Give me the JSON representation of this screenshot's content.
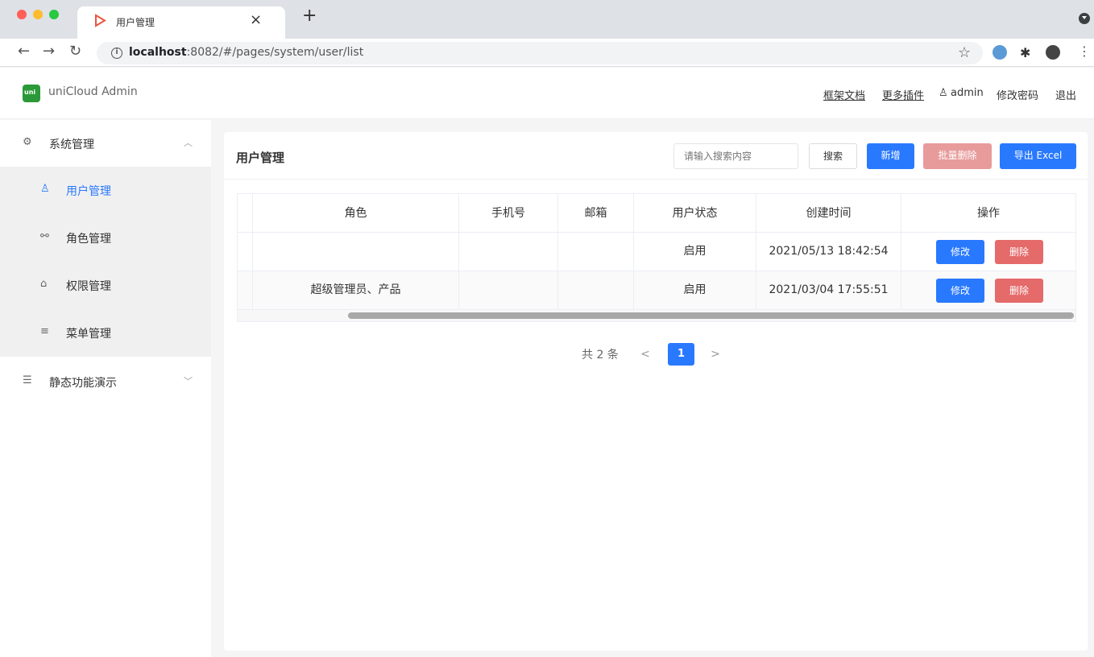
{
  "browser": {
    "tab_title": "用户管理",
    "tab_close": "×",
    "new_tab": "+",
    "url_host": "localhost",
    "url_rest": ":8082/#/pages/system/user/list"
  },
  "header": {
    "app_name": "uniCloud Admin",
    "links": {
      "docs": "框架文档",
      "plugins": "更多插件"
    },
    "user": "admin",
    "change_password": "修改密码",
    "logout": "退出"
  },
  "sidebar": {
    "system_group": {
      "label": "系统管理",
      "icon": "gear-icon",
      "expanded": true
    },
    "items": [
      {
        "label": "用户管理",
        "icon": "user-icon",
        "active": true
      },
      {
        "label": "角色管理",
        "icon": "role-icon",
        "active": false
      },
      {
        "label": "权限管理",
        "icon": "lock-icon",
        "active": false
      },
      {
        "label": "菜单管理",
        "icon": "menu-icon",
        "active": false
      }
    ],
    "demo_group": {
      "label": "静态功能演示",
      "icon": "list-icon",
      "expanded": false
    }
  },
  "page": {
    "title": "用户管理",
    "search_placeholder": "请输入搜索内容",
    "buttons": {
      "search": "搜索",
      "add": "新增",
      "batch_delete": "批量删除",
      "export": "导出 Excel"
    }
  },
  "table": {
    "columns": [
      "",
      "角色",
      "手机号",
      "邮箱",
      "用户状态",
      "创建时间",
      "操作"
    ],
    "rows": [
      {
        "role": "",
        "phone": "",
        "email": "",
        "status": "启用",
        "created": "2021/05/13 18:42:54"
      },
      {
        "role": "超级管理员、产品",
        "phone": "",
        "email": "",
        "status": "启用",
        "created": "2021/03/04 17:55:51"
      }
    ],
    "row_actions": {
      "edit": "修改",
      "delete": "删除"
    }
  },
  "pagination": {
    "total_text": "共 2 条",
    "current_page": "1",
    "prev": "<",
    "next": ">"
  },
  "colors": {
    "primary": "#2979ff",
    "danger": "#e56a6a",
    "danger_disabled": "#e89b9b",
    "brand_green": "#2b9939"
  }
}
